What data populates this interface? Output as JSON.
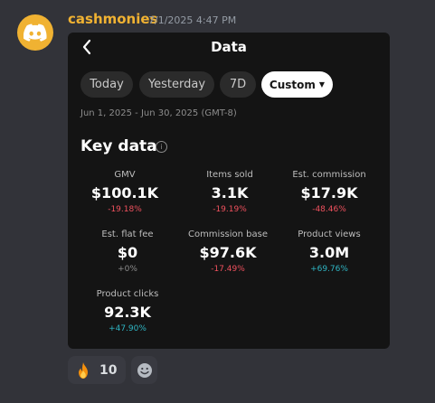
{
  "message": {
    "username": "cashmonies",
    "timestamp": "7/1/2025 4:47 PM"
  },
  "card": {
    "title": "Data",
    "tabs": [
      {
        "label": "Today",
        "active": false
      },
      {
        "label": "Yesterday",
        "active": false
      },
      {
        "label": "7D",
        "active": false
      },
      {
        "label": "Custom",
        "active": true
      }
    ],
    "date_range": "Jun 1, 2025 - Jun 30, 2025 (GMT-8)",
    "section_title": "Key data",
    "metrics": [
      {
        "label": "GMV",
        "value": "$100.1K",
        "change": "-19.18%",
        "trend": "down"
      },
      {
        "label": "Items sold",
        "value": "3.1K",
        "change": "-19.19%",
        "trend": "down"
      },
      {
        "label": "Est. commission",
        "value": "$17.9K",
        "change": "-48.46%",
        "trend": "down"
      },
      {
        "label": "Est. flat fee",
        "value": "$0",
        "change": "+0%",
        "trend": "flat"
      },
      {
        "label": "Commission base",
        "value": "$97.6K",
        "change": "-17.49%",
        "trend": "down"
      },
      {
        "label": "Product views",
        "value": "3.0M",
        "change": "+69.76%",
        "trend": "up"
      },
      {
        "label": "Product clicks",
        "value": "92.3K",
        "change": "+47.90%",
        "trend": "up"
      }
    ]
  },
  "reactions": {
    "fire": {
      "emoji": "fire-icon",
      "count": "10"
    },
    "add_icon": "add-reaction-icon"
  },
  "colors": {
    "username": "#f0b232",
    "negative": "#f0515e",
    "positive": "#2fb5c3"
  }
}
